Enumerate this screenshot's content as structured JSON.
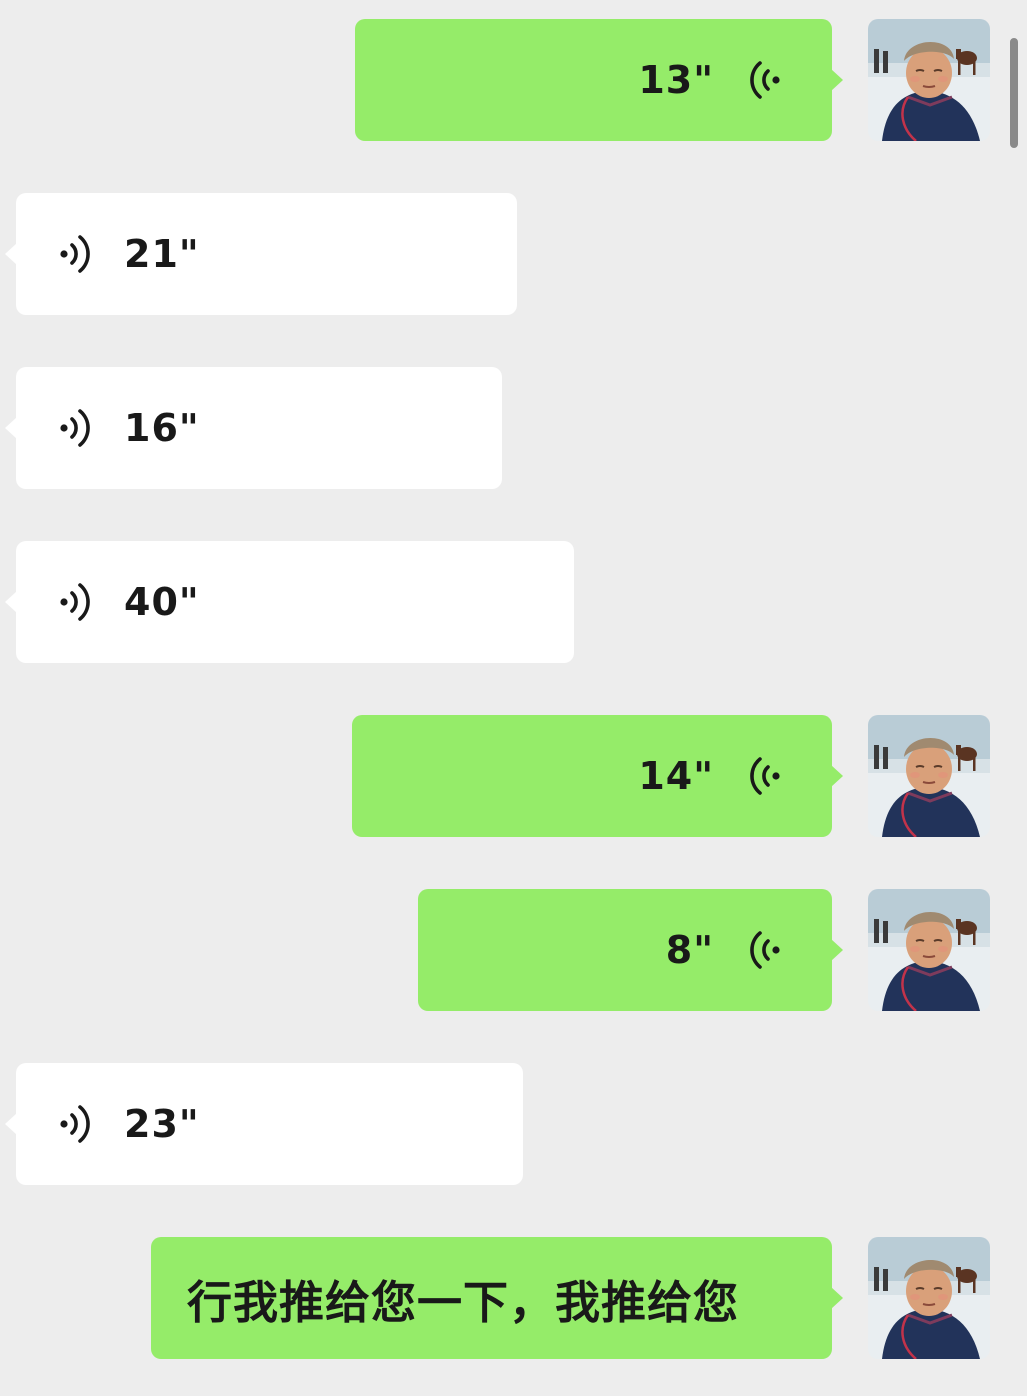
{
  "chat": {
    "messages": [
      {
        "direction": "outgoing",
        "kind": "voice",
        "duration": "13\"",
        "icon": "voice-playing-icon"
      },
      {
        "direction": "incoming",
        "kind": "voice",
        "duration": "21\"",
        "icon": "voice-playing-icon"
      },
      {
        "direction": "incoming",
        "kind": "voice",
        "duration": "16\"",
        "icon": "voice-playing-icon"
      },
      {
        "direction": "incoming",
        "kind": "voice",
        "duration": "40\"",
        "icon": "voice-playing-icon"
      },
      {
        "direction": "outgoing",
        "kind": "voice",
        "duration": "14\"",
        "icon": "voice-playing-icon"
      },
      {
        "direction": "outgoing",
        "kind": "voice",
        "duration": "8\"",
        "icon": "voice-playing-icon"
      },
      {
        "direction": "incoming",
        "kind": "voice",
        "duration": "23\"",
        "icon": "voice-playing-icon"
      },
      {
        "direction": "outgoing",
        "kind": "text",
        "text": "行我推给您一下，我推给您"
      }
    ],
    "avatar": {
      "icon": "user-avatar-photo"
    }
  },
  "colors": {
    "background": "#ededed",
    "outgoing_bubble": "#95ec69",
    "incoming_bubble": "#ffffff",
    "text": "#191919"
  }
}
